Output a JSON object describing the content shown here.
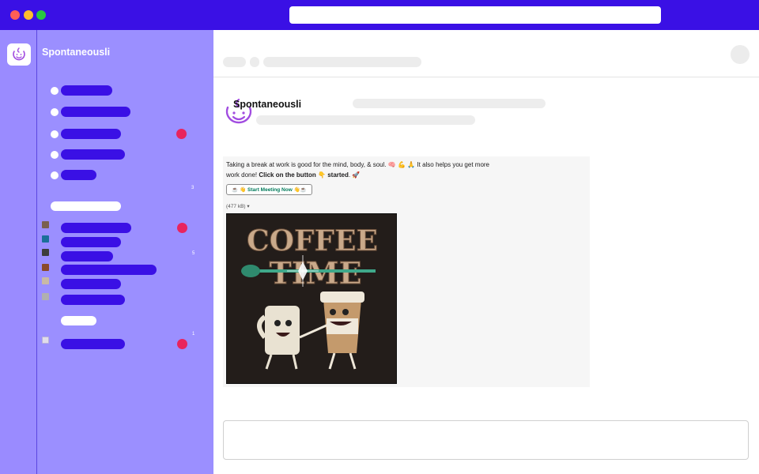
{
  "workspace": {
    "name": "Spontaneousli"
  },
  "sidebar": {
    "unread_counts": [
      "3",
      "5",
      "1"
    ]
  },
  "message": {
    "author": "Spontaneousli",
    "text_part1": "Taking a break at work is good for the mind, body, & soul. 🧠 💪 🙏  It also helps you get more work done! ",
    "text_bold": "Click on the button",
    "text_part2": " 👇 ",
    "text_bold2": "started",
    "text_part3": ". 🚀",
    "button_label": "☕ 👋 Start Meeting Now 👋☕",
    "file_size": "(477 kB)",
    "image_alt": "Coffee Time",
    "image_title_line1": "COFFEE",
    "image_title_line2": "TIME"
  },
  "colors": {
    "brand": "#3a10e5",
    "sidebar": "#9b8fff",
    "unread": "#e8245e",
    "link_green": "#007a5a"
  }
}
